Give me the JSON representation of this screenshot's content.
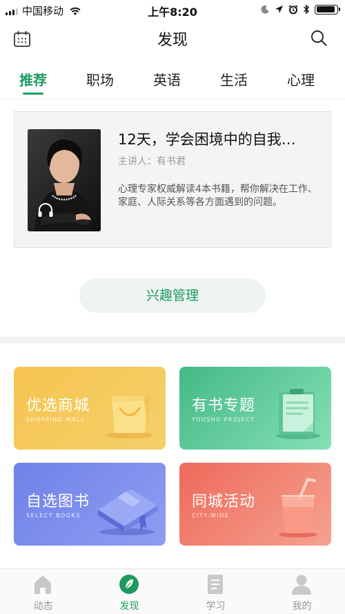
{
  "status_bar": {
    "carrier": "中国移动",
    "time": "上午8:20"
  },
  "nav": {
    "title": "发现"
  },
  "tabs": [
    {
      "label": "推荐",
      "active": true
    },
    {
      "label": "职场",
      "active": false
    },
    {
      "label": "英语",
      "active": false
    },
    {
      "label": "生活",
      "active": false
    },
    {
      "label": "心理",
      "active": false
    }
  ],
  "course": {
    "title": "12天，学会困境中的自我…",
    "lecturer": "主讲人：有书君",
    "description": "心理专家权威解读4本书籍，帮你解决在工作、家庭、人际关系等各方面遇到的问题。"
  },
  "interest_button": "兴趣管理",
  "tiles": [
    {
      "title": "优选商城",
      "subtitle": "SHOPPING MALL",
      "icon": "shopping-bag-icon",
      "color": "#f6c451"
    },
    {
      "title": "有书专题",
      "subtitle": "YOUSHU PROJECT",
      "icon": "clipboard-icon",
      "color": "#44b987"
    },
    {
      "title": "自选图书",
      "subtitle": "SELECT BOOKS",
      "icon": "book-icon",
      "color": "#6f82e8"
    },
    {
      "title": "同城活动",
      "subtitle": "CITY-WIDE",
      "icon": "drink-cup-icon",
      "color": "#ee6a5b"
    }
  ],
  "bottom_nav": [
    {
      "label": "动态",
      "icon": "home-icon",
      "active": false
    },
    {
      "label": "发现",
      "icon": "discover-leaf-icon",
      "active": true
    },
    {
      "label": "学习",
      "icon": "document-icon",
      "active": false
    },
    {
      "label": "我的",
      "icon": "user-icon",
      "active": false
    }
  ],
  "colors": {
    "accent": "#1d9b5f"
  }
}
